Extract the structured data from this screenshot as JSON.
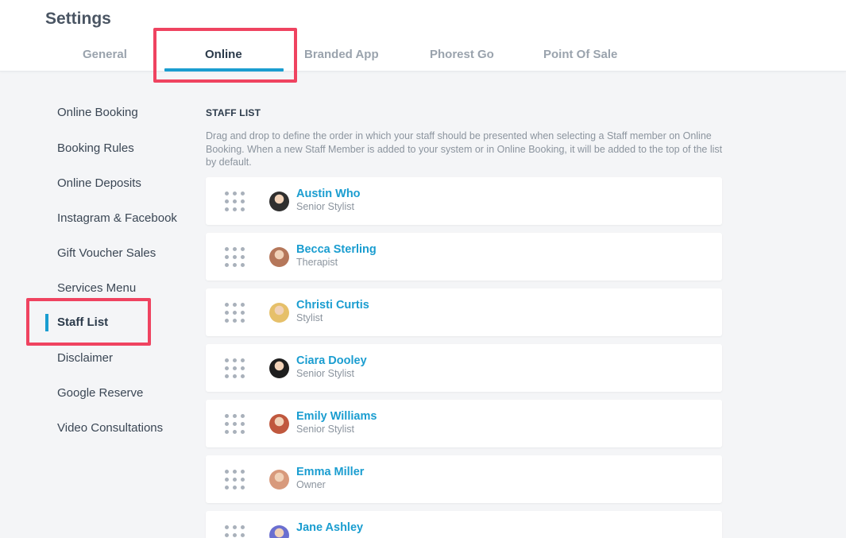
{
  "header": {
    "title": "Settings",
    "tabs": [
      {
        "label": "General"
      },
      {
        "label": "Online"
      },
      {
        "label": "Branded App"
      },
      {
        "label": "Phorest Go"
      },
      {
        "label": "Point Of Sale"
      }
    ],
    "active_tab": "Online"
  },
  "sidebar": {
    "items": [
      {
        "label": "Online Booking"
      },
      {
        "label": "Booking Rules"
      },
      {
        "label": "Online Deposits"
      },
      {
        "label": "Instagram & Facebook"
      },
      {
        "label": "Gift Voucher Sales"
      },
      {
        "label": "Services Menu"
      },
      {
        "label": "Staff List"
      },
      {
        "label": "Disclaimer"
      },
      {
        "label": "Google Reserve"
      },
      {
        "label": "Video Consultations"
      }
    ],
    "active_item": "Staff List"
  },
  "content": {
    "section_title": "STAFF LIST",
    "description": "Drag and drop to define the order in which your staff should be presented when selecting a Staff member on Online Booking. When a new Staff Member is added to your system or in Online Booking, it will be added to the top of the list by default.",
    "staff": [
      {
        "name": "Austin Who",
        "role": "Senior Stylist",
        "avatar_color": "#2f2f2f"
      },
      {
        "name": "Becca Sterling",
        "role": "Therapist",
        "avatar_color": "#b5775a"
      },
      {
        "name": "Christi Curtis",
        "role": "Stylist",
        "avatar_color": "#e6c06a"
      },
      {
        "name": "Ciara Dooley",
        "role": "Senior Stylist",
        "avatar_color": "#1e1e1e"
      },
      {
        "name": "Emily Williams",
        "role": "Senior Stylist",
        "avatar_color": "#c0583e"
      },
      {
        "name": "Emma Miller",
        "role": "Owner",
        "avatar_color": "#d89a7c"
      },
      {
        "name": "Jane Ashley",
        "role": "",
        "avatar_color": "#6b6fd0"
      }
    ]
  },
  "colors": {
    "accent": "#1a9dd0",
    "highlight": "#ef4360",
    "background": "#f4f5f7"
  }
}
